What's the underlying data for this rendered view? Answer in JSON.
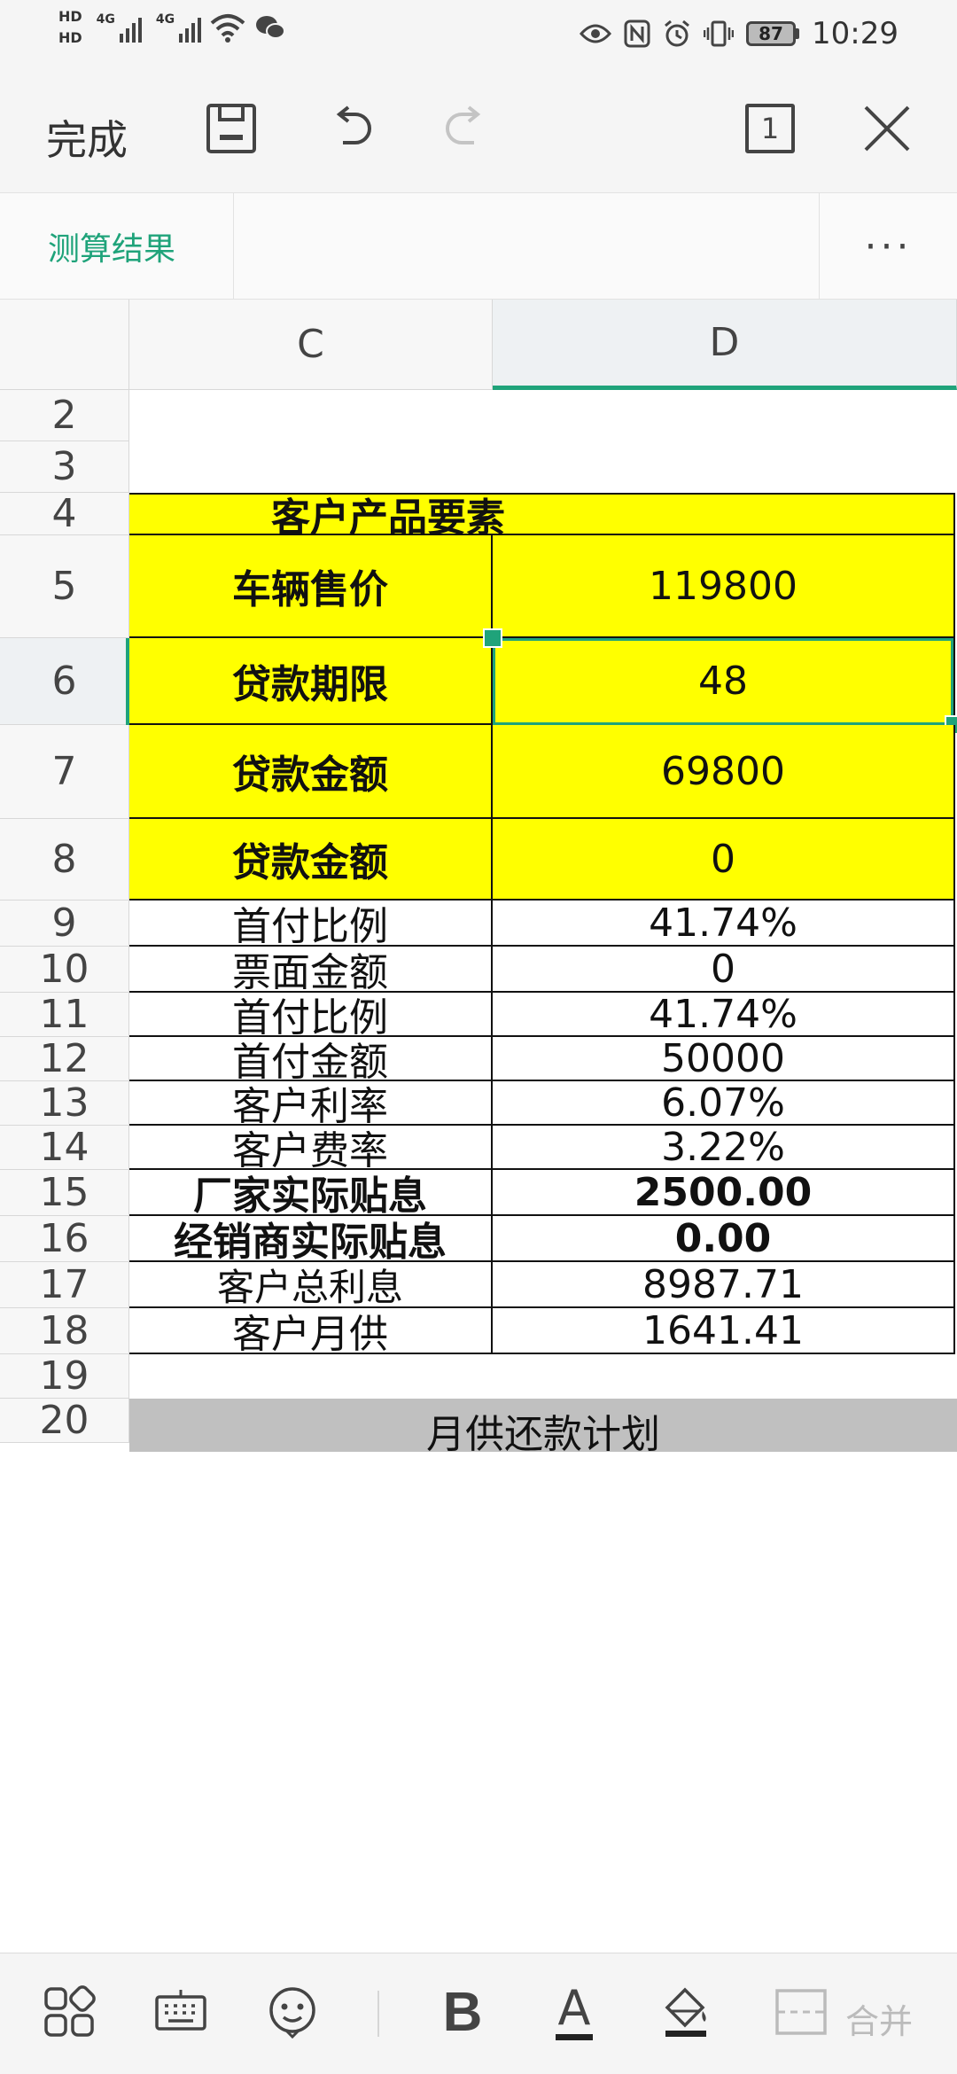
{
  "statusbar": {
    "hd1": "HD",
    "hd2": "HD",
    "net1": "4G",
    "net2": "4G",
    "battery": "87",
    "time": "10:29"
  },
  "toolbar": {
    "done_label": "完成",
    "page_count": "1"
  },
  "sheet_tab": {
    "active": "测算结果",
    "more": "···"
  },
  "columns": [
    "C",
    "D"
  ],
  "rows": [
    {
      "num": "2",
      "c": "",
      "d": ""
    },
    {
      "num": "3",
      "c": "",
      "d": ""
    },
    {
      "num": "4",
      "c": "客户产品要素",
      "d": ""
    },
    {
      "num": "5",
      "c": "车辆售价",
      "d": "119800"
    },
    {
      "num": "6",
      "c": "贷款期限",
      "d": "48"
    },
    {
      "num": "7",
      "c": "贷款金额",
      "d": "69800"
    },
    {
      "num": "8",
      "c": "贷款金额",
      "d": "0"
    },
    {
      "num": "9",
      "c": "首付比例",
      "d": "41.74%"
    },
    {
      "num": "10",
      "c": "票面金额",
      "d": "0"
    },
    {
      "num": "11",
      "c": "首付比例",
      "d": "41.74%"
    },
    {
      "num": "12",
      "c": "首付金额",
      "d": "50000"
    },
    {
      "num": "13",
      "c": "客户利率",
      "d": "6.07%"
    },
    {
      "num": "14",
      "c": "客户费率",
      "d": "3.22%"
    },
    {
      "num": "15",
      "c": "厂家实际贴息",
      "d": "2500.00"
    },
    {
      "num": "16",
      "c": "经销商实际贴息",
      "d": "0.00"
    },
    {
      "num": "17",
      "c": "客户总利息",
      "d": "8987.71"
    },
    {
      "num": "18",
      "c": "客户月供",
      "d": "1641.41"
    },
    {
      "num": "19",
      "c": "",
      "d": ""
    },
    {
      "num": "20",
      "c": "月供还款计划",
      "d": ""
    }
  ],
  "bottombar": {
    "bold": "B",
    "font_color": "A",
    "merge": "合并"
  },
  "colors": {
    "accent": "#1fa37a",
    "highlight": "#ffff00"
  }
}
